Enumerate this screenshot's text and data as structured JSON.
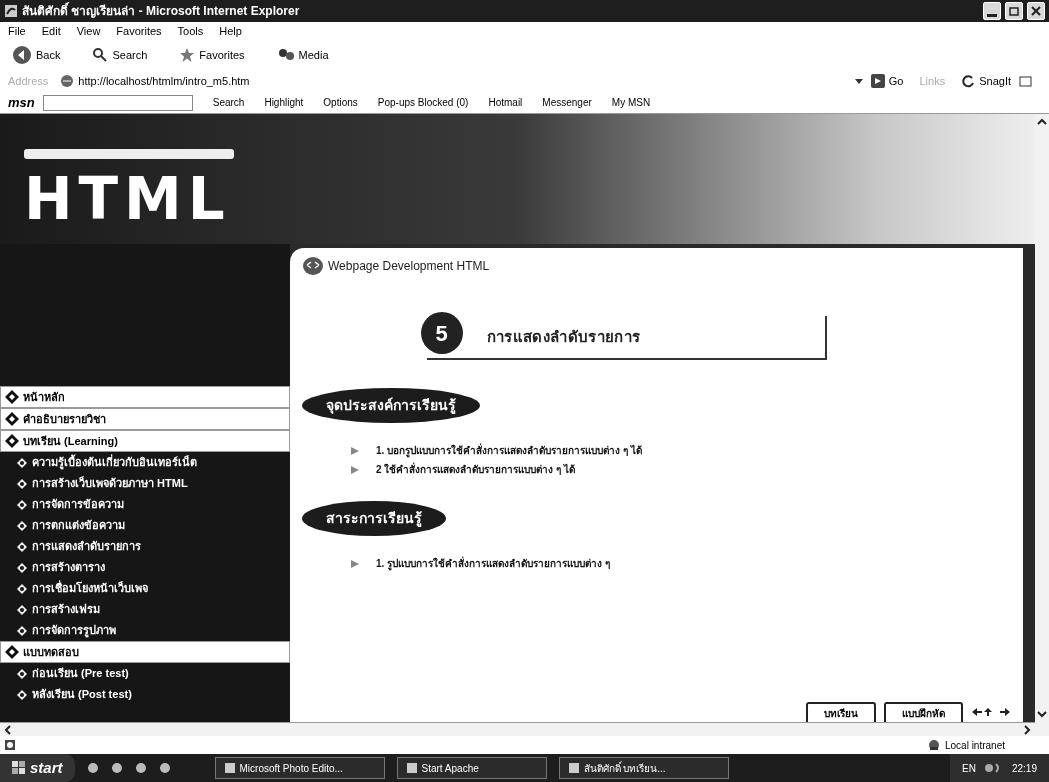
{
  "window": {
    "title": "สันติศักดิ์ ชาญเรียนล่า - Microsoft Internet Explorer"
  },
  "menu_bar": [
    "File",
    "Edit",
    "View",
    "Favorites",
    "Tools",
    "Help"
  ],
  "toolbar": [
    {
      "kind": "back",
      "label": "Back"
    },
    {
      "kind": "search",
      "label": "Search"
    },
    {
      "kind": "favorites",
      "label": "Favorites"
    },
    {
      "kind": "media",
      "label": "Media"
    }
  ],
  "address_bar": {
    "label": "Address",
    "url": "http://localhost/htmlm/intro_m5.htm",
    "go": "Go",
    "links": "Links",
    "snagit": "SnagIt"
  },
  "msn_bar": {
    "logo": "msn",
    "items": [
      "Search",
      "Highlight",
      "Options",
      "Pop-ups Blocked (0)",
      "Hotmail",
      "Messenger",
      "My MSN"
    ]
  },
  "page": {
    "banner": "HTML",
    "sidebar": [
      {
        "label": "หน้าหลัก"
      },
      {
        "label": "คำอธิบายรายวิชา"
      },
      {
        "label": "บทเรียน (Learning)",
        "children": [
          {
            "label": "ความรู้เบื้องต้นเกี่ยวกับอินเทอร์เน็ต"
          },
          {
            "label": "การสร้างเว็บเพจด้วยภาษา HTML"
          },
          {
            "label": "การจัดการข้อความ"
          },
          {
            "label": "การตกแต่งข้อความ"
          },
          {
            "label": "การแสดงลำดับรายการ"
          },
          {
            "label": "การสร้างตาราง"
          },
          {
            "label": "การเชื่อมโยงหน้าเว็บเพจ"
          },
          {
            "label": "การสร้างเฟรม"
          },
          {
            "label": "การจัดการรูปภาพ"
          }
        ]
      },
      {
        "label": "แบบทดสอบ",
        "children": [
          {
            "label": "ก่อนเรียน (Pre test)"
          },
          {
            "label": "หลังเรียน (Post test)"
          }
        ]
      }
    ],
    "breadcrumb": "Webpage Development HTML",
    "chapter_number": "5",
    "chapter_title": "การแสดงลำดับรายการ",
    "sections": [
      {
        "heading": "จุดประสงค์การเรียนรู้",
        "items": [
          "1. บอกรูปแบบการใช้คำสั่งการแสดงลำดับรายการแบบต่าง ๆ ได้",
          "2 ใช้คำสั่งการแสดงลำดับรายการแบบต่าง ๆ ได้"
        ]
      },
      {
        "heading": "สาระการเรียนรู้",
        "items": [
          "1. รูปแบบการใช้คำสั่งการแสดงลำดับรายการแบบต่าง ๆ"
        ]
      }
    ],
    "buttons": [
      "บทเรียน",
      "แบบฝึกหัด"
    ]
  },
  "status_bar": {
    "zone": "Local intranet"
  },
  "taskbar": {
    "start": "start",
    "tasks": [
      "Microsoft Photo Edito...",
      "Start Apache",
      "สันติศักดิ์ บทเรียน..."
    ],
    "language": "EN",
    "time": "22:19"
  }
}
